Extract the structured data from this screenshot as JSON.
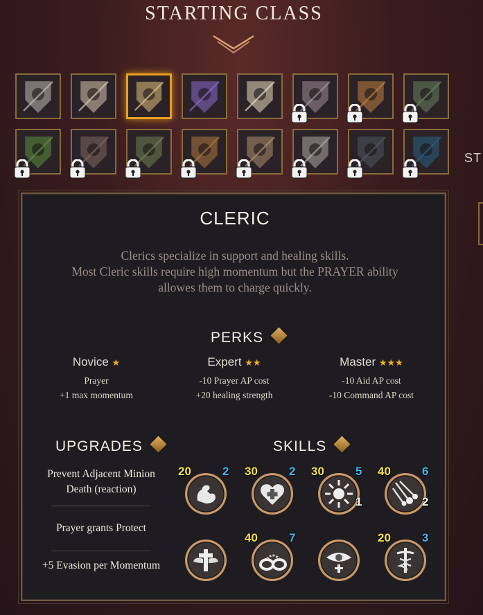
{
  "header": {
    "title": "STARTING CLASS"
  },
  "side": {
    "label": "ST"
  },
  "class_grid": {
    "rows": [
      [
        {
          "name": "sword-shield-class-icon",
          "locked": false,
          "selected": false,
          "color": "#c0b8b0"
        },
        {
          "name": "stag-skull-class-icon",
          "locked": false,
          "selected": false,
          "color": "#d8c8b0"
        },
        {
          "name": "praying-hands-class-icon",
          "locked": false,
          "selected": true,
          "color": "#e0c080"
        },
        {
          "name": "hooded-mage-class-icon",
          "locked": false,
          "selected": false,
          "color": "#8a6ad0"
        },
        {
          "name": "open-book-class-icon",
          "locked": false,
          "selected": false,
          "color": "#e8dcc0"
        },
        {
          "name": "skull-class-icon",
          "locked": true,
          "selected": false,
          "color": "#a09098"
        },
        {
          "name": "crossed-axes-class-icon",
          "locked": true,
          "selected": false,
          "color": "#c08040"
        },
        {
          "name": "beast-class-icon",
          "locked": true,
          "selected": false,
          "color": "#6a8060"
        }
      ],
      [
        {
          "name": "thorn-plant-class-icon",
          "locked": true,
          "selected": false,
          "color": "#5a9040"
        },
        {
          "name": "spider-class-icon",
          "locked": true,
          "selected": false,
          "color": "#806860"
        },
        {
          "name": "hooded-figure-class-icon",
          "locked": true,
          "selected": false,
          "color": "#708050"
        },
        {
          "name": "helmet-class-icon",
          "locked": true,
          "selected": false,
          "color": "#b07840"
        },
        {
          "name": "orc-skull-class-icon",
          "locked": true,
          "selected": false,
          "color": "#b09070"
        },
        {
          "name": "lion-crest-class-icon",
          "locked": true,
          "selected": false,
          "color": "#b0aaa8"
        },
        {
          "name": "dark-beast-class-icon",
          "locked": true,
          "selected": false,
          "color": "#505860"
        },
        {
          "name": "crystal-orb-class-icon",
          "locked": true,
          "selected": false,
          "color": "#2a6080"
        }
      ]
    ]
  },
  "panel": {
    "class_name": "CLERIC",
    "description": [
      "Clerics specialize in support and healing skills.",
      "Most Cleric skills require high momentum but the PRAYER ability",
      "allowes them to charge quickly."
    ],
    "perks_heading": "PERKS",
    "perks": [
      {
        "title": "Novice",
        "stars": "★",
        "lines": [
          "Prayer",
          "+1 max momentum"
        ]
      },
      {
        "title": "Expert",
        "stars": "★★",
        "lines": [
          "-10 Prayer AP cost",
          "+20 healing strength"
        ]
      },
      {
        "title": "Master",
        "stars": "★★★",
        "lines": [
          "-10 Aid AP cost",
          "-10 Command AP cost"
        ]
      }
    ],
    "upgrades_heading": "UPGRADES",
    "upgrades": [
      "Prevent Adjacent Minion Death (reaction)",
      "Prayer grants Protect",
      "+5 Evasion per Momentum"
    ],
    "skills_heading": "SKILLS",
    "skills": [
      {
        "icon": "flexed-arm-icon",
        "ap": "20",
        "momentum": "2",
        "cooldown": ""
      },
      {
        "icon": "heart-cross-icon",
        "ap": "30",
        "momentum": "2",
        "cooldown": ""
      },
      {
        "icon": "radiant-burst-icon",
        "ap": "30",
        "momentum": "5",
        "cooldown": "1"
      },
      {
        "icon": "falling-stars-icon",
        "ap": "40",
        "momentum": "6",
        "cooldown": "2"
      },
      {
        "icon": "winged-cross-icon",
        "ap": "",
        "momentum": "",
        "cooldown": ""
      },
      {
        "icon": "shackles-icon",
        "ap": "40",
        "momentum": "7",
        "cooldown": ""
      },
      {
        "icon": "all-seeing-eye-icon",
        "ap": "",
        "momentum": "",
        "cooldown": ""
      },
      {
        "icon": "caduceus-icon",
        "ap": "20",
        "momentum": "3",
        "cooldown": ""
      }
    ]
  },
  "colors": {
    "gold_border": "#8a6a3a",
    "selected_border": "#e8a020",
    "ap_number": "#f2e24a",
    "momentum_number": "#3cb8f0",
    "panel_bg": "#1f1c21"
  }
}
